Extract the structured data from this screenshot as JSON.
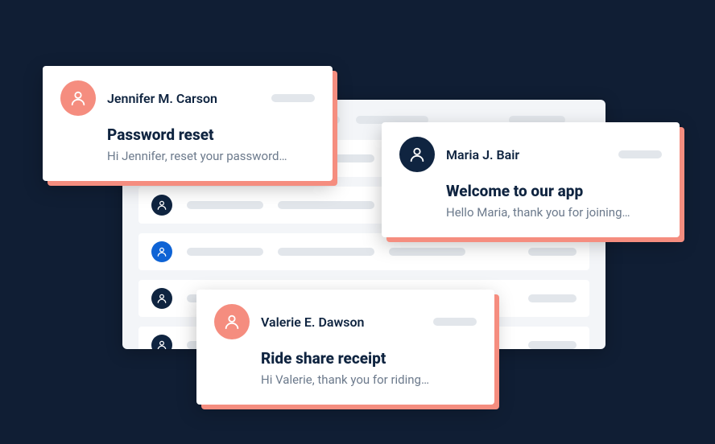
{
  "colors": {
    "background": "#101e34",
    "salmon": "#f58d7f",
    "navy": "#0f2440",
    "blue": "#0e63d5",
    "panel": "#f3f5f8",
    "placeholder": "#e2e6eb",
    "muted": "#6c7a8c"
  },
  "list": {
    "rows": [
      {
        "avatar_color": "navy"
      },
      {
        "avatar_color": "navy"
      },
      {
        "avatar_color": "blue"
      },
      {
        "avatar_color": "navy"
      },
      {
        "avatar_color": "navy"
      }
    ]
  },
  "cards": [
    {
      "id": "card-1",
      "avatar_color": "salmon",
      "sender": "Jennifer M. Carson",
      "subject": "Password reset",
      "preview": "Hi Jennifer, reset your password…"
    },
    {
      "id": "card-2",
      "avatar_color": "navy",
      "sender": "Maria J. Bair",
      "subject": "Welcome to our app",
      "preview": "Hello Maria, thank you for joining…"
    },
    {
      "id": "card-3",
      "avatar_color": "salmon",
      "sender": "Valerie E. Dawson",
      "subject": "Ride share receipt",
      "preview": "Hi Valerie, thank you for riding…"
    }
  ]
}
